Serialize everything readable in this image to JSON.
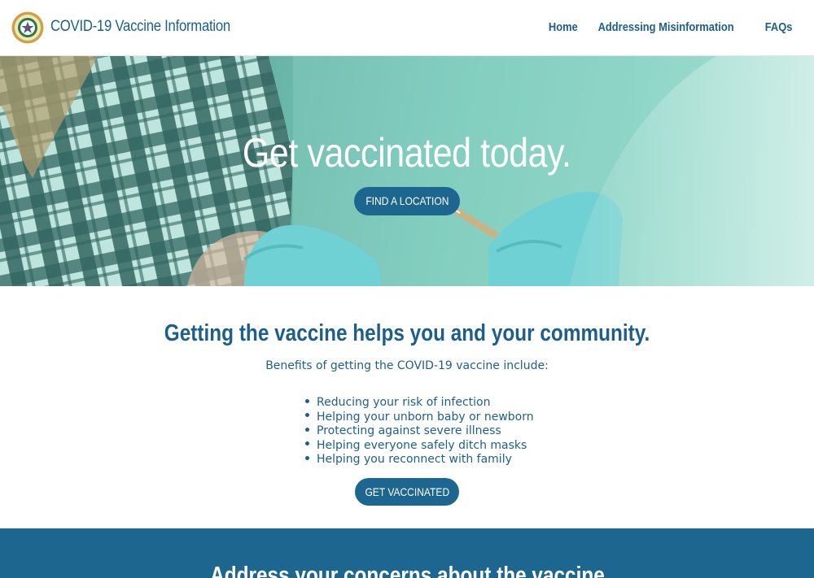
{
  "header": {
    "site_title": "COVID-19 Vaccine Information",
    "logo_icon": "county-seal-icon",
    "nav": [
      {
        "label": "Home"
      },
      {
        "label": "Addressing Misinformation"
      },
      {
        "label": "FAQs"
      }
    ]
  },
  "hero": {
    "title": "Get vaccinated today.",
    "button_label": "FIND A LOCATION"
  },
  "benefits": {
    "title": "Getting the vaccine helps you and your community.",
    "subtitle": "Benefits of getting the COVID-19 vaccine include:",
    "items": [
      "Reducing your risk of infection",
      "Helping your unborn baby or newborn",
      "Protecting against severe illness",
      "Helping everyone safely ditch masks",
      "Helping you reconnect with family"
    ],
    "button_label": "GET VACCINATED"
  },
  "concerns": {
    "title": "Address your concerns about the vaccine"
  },
  "colors": {
    "brand_blue": "#1d6690",
    "text_blue": "#1d5f8c",
    "hero_teal": "#7ccbbc"
  }
}
